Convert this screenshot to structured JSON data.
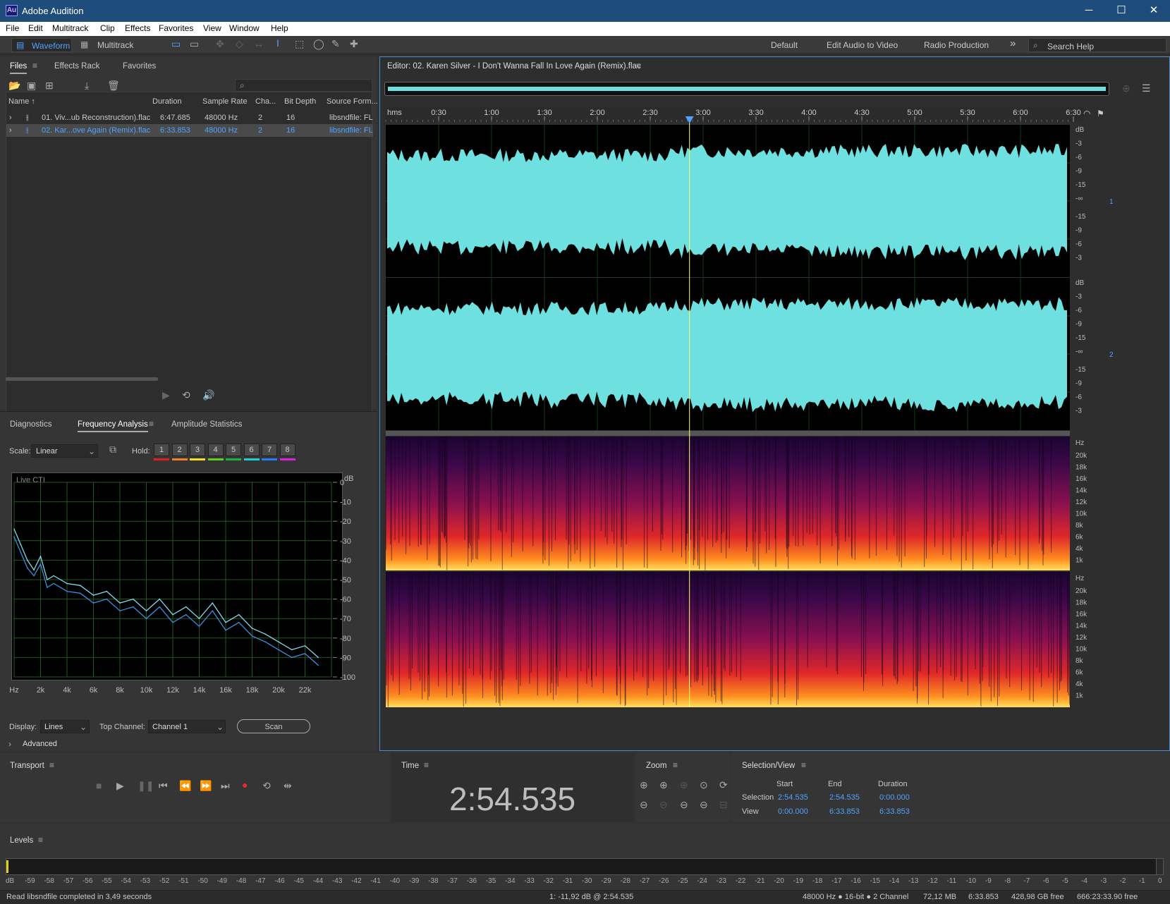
{
  "app": {
    "title": "Adobe Audition",
    "logo": "Au"
  },
  "window_buttons": [
    "─",
    "☐",
    "✕"
  ],
  "menu": [
    "File",
    "Edit",
    "Multitrack",
    "Clip",
    "Effects",
    "Favorites",
    "View",
    "Window",
    "Help"
  ],
  "toolbar": {
    "waveform": "Waveform",
    "multitrack": "Multitrack",
    "workspaces": [
      "Default",
      "Edit Audio to Video",
      "Radio Production"
    ],
    "more": "»",
    "search": "Search Help"
  },
  "files": {
    "tabs": [
      "Files",
      "Effects Rack",
      "Favorites"
    ],
    "columns": [
      "Name ↑",
      "Duration",
      "Sample Rate",
      "Cha...",
      "Bit Depth",
      "Source Form..."
    ],
    "rows": [
      {
        "name": "01. Viv...ub Reconstruction).flac",
        "duration": "6:47.685",
        "rate": "48000 Hz",
        "ch": "2",
        "bit": "16",
        "src": "libsndfile: FL"
      },
      {
        "name": "02. Kar...ove Again (Remix).flac",
        "duration": "6:33.853",
        "rate": "48000 Hz",
        "ch": "2",
        "bit": "16",
        "src": "libsndfile: FL"
      }
    ]
  },
  "analysis": {
    "tabs": [
      "Diagnostics",
      "Frequency Analysis",
      "Amplitude Statistics"
    ],
    "scale_label": "Scale:",
    "scale_value": "Linear",
    "hold_label": "Hold:",
    "holds": [
      "1",
      "2",
      "3",
      "4",
      "5",
      "6",
      "7",
      "8"
    ],
    "hold_colors": [
      "#e02020",
      "#f08020",
      "#f0e020",
      "#60d020",
      "#20b040",
      "#20d0d0",
      "#2080ff",
      "#e020e0"
    ],
    "live_label": "Live CTI",
    "db_unit": "dB",
    "display_label": "Display:",
    "display_value": "Lines",
    "top_channel_label": "Top Channel:",
    "top_channel_value": "Channel 1",
    "scan": "Scan",
    "advanced": "Advanced"
  },
  "chart_data": {
    "type": "line",
    "x_tick_labels": [
      "Hz",
      "2k",
      "4k",
      "6k",
      "8k",
      "10k",
      "12k",
      "14k",
      "16k",
      "18k",
      "20k",
      "22k"
    ],
    "y_tick_labels": [
      "0",
      "-10",
      "-20",
      "-30",
      "-40",
      "-50",
      "-60",
      "-70",
      "-80",
      "-90",
      "-100"
    ],
    "ylabel": "dB",
    "xlim": [
      0,
      24000
    ],
    "ylim": [
      -100,
      0
    ],
    "series": [
      {
        "color": "#7fd8e8",
        "x": [
          0,
          500,
          1000,
          1500,
          2000,
          2500,
          3000,
          4000,
          5000,
          6000,
          7000,
          8000,
          9000,
          10000,
          11000,
          12000,
          13000,
          14000,
          15000,
          16000,
          17000,
          18000,
          19000,
          20000,
          21000,
          22000,
          23000
        ],
        "y": [
          -24,
          -32,
          -40,
          -45,
          -38,
          -50,
          -48,
          -52,
          -53,
          -58,
          -56,
          -62,
          -60,
          -66,
          -60,
          -68,
          -64,
          -70,
          -62,
          -72,
          -68,
          -75,
          -78,
          -82,
          -86,
          -84,
          -90
        ]
      },
      {
        "color": "#3a8ee0",
        "x": [
          0,
          500,
          1000,
          1500,
          2000,
          2500,
          3000,
          4000,
          5000,
          6000,
          7000,
          8000,
          9000,
          10000,
          11000,
          12000,
          13000,
          14000,
          15000,
          16000,
          17000,
          18000,
          19000,
          20000,
          21000,
          22000,
          23000
        ],
        "y": [
          -28,
          -36,
          -44,
          -48,
          -42,
          -54,
          -52,
          -56,
          -57,
          -62,
          -60,
          -66,
          -64,
          -70,
          -64,
          -72,
          -68,
          -74,
          -66,
          -76,
          -72,
          -79,
          -82,
          -86,
          -90,
          -88,
          -94
        ]
      }
    ]
  },
  "editor": {
    "title": "Editor: 02. Karen Silver - I Don't Wanna Fall In Love Again (Remix).flac",
    "ruler": [
      "hms",
      "0:30",
      "1:00",
      "1:30",
      "2:00",
      "2:30",
      "3:00",
      "3:30",
      "4:00",
      "4:30",
      "5:00",
      "5:30",
      "6:00",
      "6:30"
    ],
    "db_ticks": [
      "dB",
      "-3",
      "-6",
      "-9",
      "-15",
      "-∞",
      "-15",
      "-9",
      "-6",
      "-3"
    ],
    "hz_ticks": [
      "Hz",
      "20k",
      "18k",
      "16k",
      "14k",
      "12k",
      "10k",
      "8k",
      "6k",
      "4k",
      "1k"
    ],
    "ch1": "1",
    "ch2": "2",
    "playhead_fraction": 0.444
  },
  "transport": {
    "title": "Transport"
  },
  "time": {
    "title": "Time",
    "value": "2:54.535"
  },
  "zoom": {
    "title": "Zoom"
  },
  "selview": {
    "title": "Selection/View",
    "cols": [
      "Start",
      "End",
      "Duration"
    ],
    "selection": {
      "label": "Selection",
      "start": "2:54.535",
      "end": "2:54.535",
      "duration": "0:00.000"
    },
    "view": {
      "label": "View",
      "start": "0:00.000",
      "end": "6:33.853",
      "duration": "6:33.853"
    }
  },
  "levels": {
    "title": "Levels",
    "scale": [
      "dB",
      "-59",
      "-58",
      "-57",
      "-56",
      "-55",
      "-54",
      "-53",
      "-52",
      "-51",
      "-50",
      "-49",
      "-48",
      "-47",
      "-46",
      "-45",
      "-44",
      "-43",
      "-42",
      "-41",
      "-40",
      "-39",
      "-38",
      "-37",
      "-36",
      "-35",
      "-34",
      "-33",
      "-32",
      "-31",
      "-30",
      "-29",
      "-28",
      "-27",
      "-26",
      "-25",
      "-24",
      "-23",
      "-22",
      "-21",
      "-20",
      "-19",
      "-18",
      "-17",
      "-16",
      "-15",
      "-14",
      "-13",
      "-12",
      "-11",
      "-10",
      "-9",
      "-8",
      "-7",
      "-6",
      "-5",
      "-4",
      "-3",
      "-2",
      "-1",
      "0"
    ]
  },
  "status": {
    "left": "Read libsndfile completed in 3,49 seconds",
    "cursor": "1: -11,92 dB @ 2:54.535",
    "format": "48000 Hz ● 16-bit ● 2 Channel",
    "size": "72,12 MB",
    "duration": "6:33.853",
    "free": "428,98 GB free",
    "time_free": "666:23:33.90 free"
  }
}
